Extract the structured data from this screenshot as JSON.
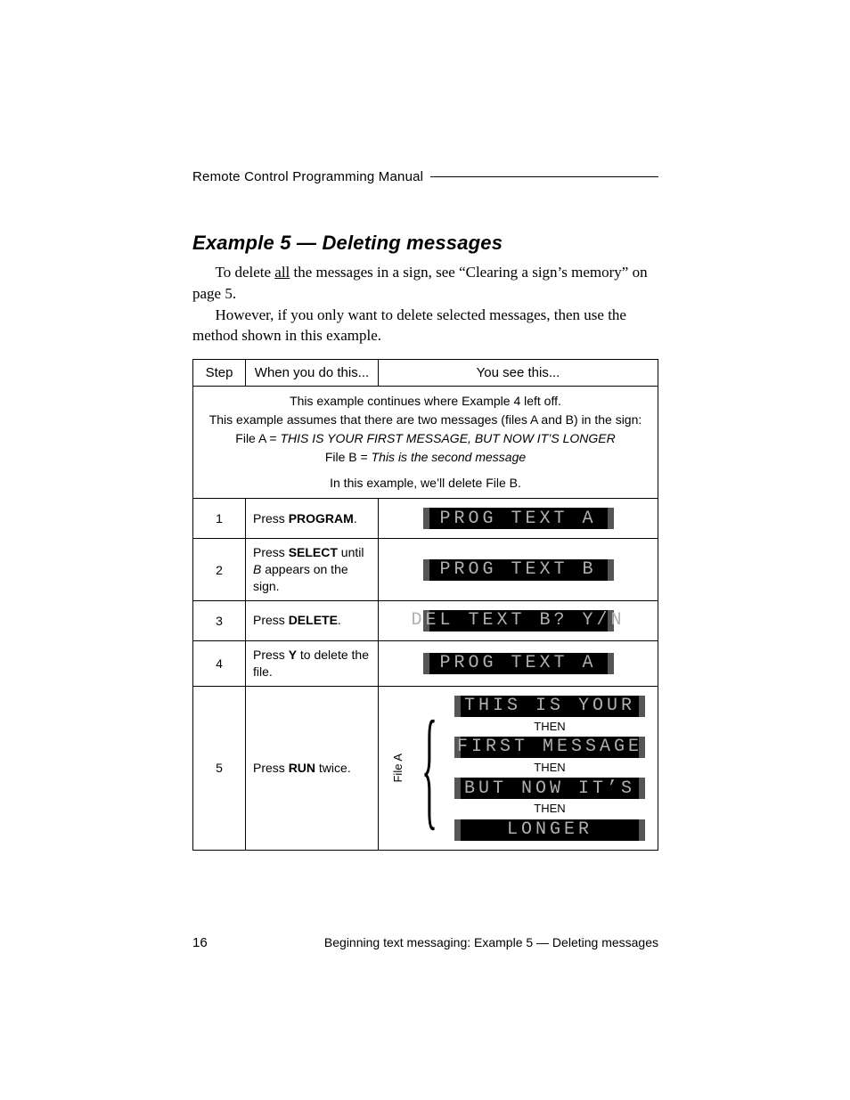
{
  "header": {
    "running": "Remote Control Programming Manual"
  },
  "title": "Example 5 — Deleting messages",
  "paras": {
    "p1a": "To delete ",
    "p1b": "all",
    "p1c": " the messages in a sign, see “Clearing a sign’s memory” on page 5.",
    "p2": "However, if you only want to delete selected messages, then use the method shown in this example."
  },
  "table": {
    "head": {
      "step": "Step",
      "when": "When you do this...",
      "see": "You see this..."
    },
    "intro": {
      "l1": "This example continues where Example 4 left off.",
      "l2": "This example assumes that there are two messages (files A and B) in the sign:",
      "l3a": "File A = ",
      "l3b": "THIS IS YOUR FIRST MESSAGE, BUT NOW IT’S LONGER",
      "l4a": "File B = ",
      "l4b": "This is the second message",
      "l5": "In this example, we’ll delete File B."
    },
    "rows": {
      "r1": {
        "num": "1",
        "whenA": "Press ",
        "whenB": "PROGRAM",
        "whenC": ".",
        "sign": "PROG TEXT A"
      },
      "r2": {
        "num": "2",
        "whenA": "Press ",
        "whenB": "SELECT",
        "whenC": " until ",
        "whenD": "B",
        "whenE": " appears on the sign.",
        "sign": "PROG TEXT B"
      },
      "r3": {
        "num": "3",
        "whenA": "Press ",
        "whenB": "DELETE",
        "whenC": ".",
        "sign": "DEL TEXT B? Y/N"
      },
      "r4": {
        "num": "4",
        "whenA": "Press ",
        "whenB": "Y",
        "whenC": " to delete the file.",
        "sign": "PROG TEXT A"
      },
      "r5": {
        "num": "5",
        "whenA": "Press ",
        "whenB": "RUN",
        "whenC": " twice.",
        "bracketLabel": "File A",
        "sign1": "THIS IS YOUR",
        "then1": "THEN",
        "sign2": "FIRST MESSAGE",
        "then2": "THEN",
        "sign3": "BUT NOW IT’S",
        "then3": "THEN",
        "sign4": "LONGER"
      }
    }
  },
  "footer": {
    "pageno": "16",
    "text": "Beginning text messaging: Example 5 — Deleting messages"
  }
}
